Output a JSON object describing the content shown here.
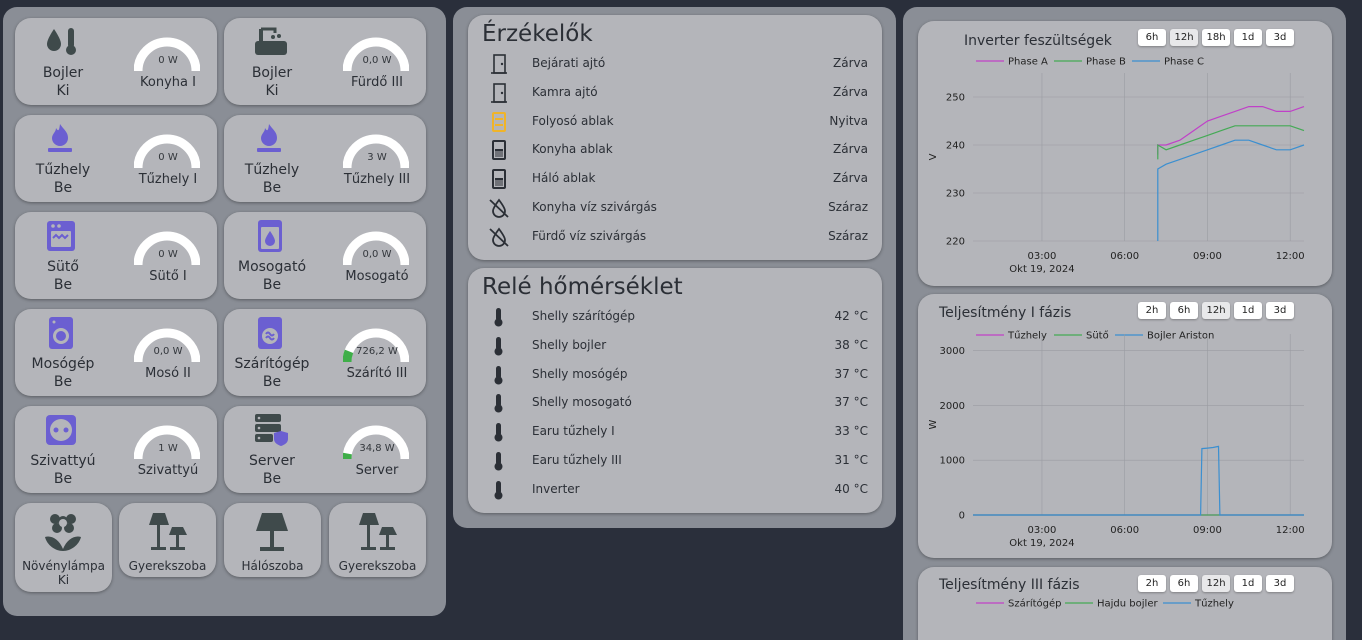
{
  "tiles": [
    {
      "icon": "water-thermometer-icon",
      "name": "Bojler",
      "state": "Ki",
      "gauge_value": "0 W",
      "gauge_name": "Konyha I",
      "fill": 0,
      "icon_color": "#3f4a4b"
    },
    {
      "icon": "bathtub-icon",
      "name": "Bojler",
      "state": "Ki",
      "gauge_value": "0,0 W",
      "gauge_name": "Fürdő III",
      "fill": 0,
      "icon_color": "#3f4a4b"
    },
    {
      "icon": "gas-burner-icon",
      "name": "Tűzhely",
      "state": "Be",
      "gauge_value": "0 W",
      "gauge_name": "Tűzhely I",
      "fill": 0,
      "icon_color": "#6b5fd1"
    },
    {
      "icon": "gas-burner-icon",
      "name": "Tűzhely",
      "state": "Be",
      "gauge_value": "3 W",
      "gauge_name": "Tűzhely III",
      "fill": 0,
      "icon_color": "#6b5fd1"
    },
    {
      "icon": "oven-icon",
      "name": "Sütő",
      "state": "Be",
      "gauge_value": "0 W",
      "gauge_name": "Sütő I",
      "fill": 0,
      "icon_color": "#6b5fd1"
    },
    {
      "icon": "dishwasher-icon",
      "name": "Mosogató",
      "state": "Be",
      "gauge_value": "0,0 W",
      "gauge_name": "Mosogató",
      "fill": 0,
      "icon_color": "#6b5fd1"
    },
    {
      "icon": "washing-machine-icon",
      "name": "Mosógép",
      "state": "Be",
      "gauge_value": "0,0 W",
      "gauge_name": "Mosó II",
      "fill": 0,
      "icon_color": "#6b5fd1"
    },
    {
      "icon": "tumble-dryer-icon",
      "name": "Szárítógép",
      "state": "Be",
      "gauge_value": "726,2 W",
      "gauge_name": "Szárító III",
      "fill": 0.12,
      "icon_color": "#6b5fd1"
    },
    {
      "icon": "power-socket-icon",
      "name": "Szivattyú",
      "state": "Be",
      "gauge_value": "1 W",
      "gauge_name": "Szivattyú",
      "fill": 0,
      "icon_color": "#6b5fd1"
    },
    {
      "icon": "server-shield-icon",
      "name": "Server",
      "state": "Be",
      "gauge_value": "34,8 W",
      "gauge_name": "Server",
      "fill": 0.06,
      "icon_color": "#3f4a4b"
    }
  ],
  "bottom_buttons": [
    {
      "icon": "flower-icon",
      "name": "Növénylámpa",
      "state": "Ki"
    },
    {
      "icon": "lamps-icon",
      "name": "Gyerekszoba"
    },
    {
      "icon": "lamp-icon",
      "name": "Hálószoba"
    },
    {
      "icon": "lamps-icon",
      "name": "Gyerekszoba"
    }
  ],
  "sensors": {
    "title": "Érzékelők",
    "rows": [
      {
        "icon": "door-closed-icon",
        "label": "Bejárati ajtó",
        "value": "Zárva",
        "color": "#2b2f36"
      },
      {
        "icon": "door-closed-icon",
        "label": "Kamra ajtó",
        "value": "Zárva",
        "color": "#2b2f36"
      },
      {
        "icon": "window-open-icon",
        "label": "Folyosó ablak",
        "value": "Nyitva",
        "color": "#f0b429"
      },
      {
        "icon": "window-closed-icon",
        "label": "Konyha ablak",
        "value": "Zárva",
        "color": "#2b2f36"
      },
      {
        "icon": "window-closed-icon",
        "label": "Háló ablak",
        "value": "Zárva",
        "color": "#2b2f36"
      },
      {
        "icon": "water-off-icon",
        "label": "Konyha víz szivárgás",
        "value": "Száraz",
        "color": "#2b2f36"
      },
      {
        "icon": "water-off-icon",
        "label": "Fürdő víz szivárgás",
        "value": "Száraz",
        "color": "#2b2f36"
      }
    ]
  },
  "relay": {
    "title": "Relé hőmérséklet",
    "rows": [
      {
        "icon": "thermometer-icon",
        "label": "Shelly szárítógép",
        "value": "42 °C"
      },
      {
        "icon": "thermometer-icon",
        "label": "Shelly bojler",
        "value": "38 °C"
      },
      {
        "icon": "thermometer-icon",
        "label": "Shelly mosógép",
        "value": "37 °C"
      },
      {
        "icon": "thermometer-icon",
        "label": "Shelly mosogató",
        "value": "37 °C"
      },
      {
        "icon": "thermometer-icon",
        "label": "Earu tűzhely I",
        "value": "33 °C"
      },
      {
        "icon": "thermometer-icon",
        "label": "Earu tűzhely III",
        "value": "31 °C"
      },
      {
        "icon": "thermometer-icon",
        "label": "Inverter",
        "value": "40 °C"
      }
    ]
  },
  "charts": {
    "c1": {
      "title": "Inverter feszültségek",
      "ranges": [
        "6h",
        "12h",
        "18h",
        "1d",
        "3d"
      ],
      "active": "12h"
    },
    "c2": {
      "title": "Teljesítmény I fázis",
      "ranges": [
        "2h",
        "6h",
        "12h",
        "1d",
        "3d"
      ],
      "active": "12h"
    },
    "c3": {
      "title": "Teljesítmény III fázis",
      "ranges": [
        "2h",
        "6h",
        "12h",
        "1d",
        "3d"
      ],
      "active": "12h"
    }
  },
  "chart_data": [
    {
      "type": "line",
      "title": "Inverter feszültségek",
      "ylabel": "V",
      "ylim": [
        220,
        255
      ],
      "yticks": [
        220,
        230,
        240,
        250
      ],
      "xticks": [
        "03:00",
        "06:00",
        "09:00",
        "12:00"
      ],
      "xsub": "Okt 19, 2024",
      "xlim": [
        0.5,
        12.5
      ],
      "series": [
        {
          "name": "Phase A",
          "color": "#c040c8",
          "x": [
            7.2,
            7.2,
            7.5,
            8.0,
            8.5,
            9.0,
            9.5,
            10.0,
            10.5,
            11.0,
            11.5,
            12.0,
            12.5
          ],
          "y": [
            238,
            240,
            240,
            241,
            243,
            245,
            246,
            247,
            248,
            248,
            247,
            247,
            248
          ]
        },
        {
          "name": "Phase B",
          "color": "#44aa55",
          "x": [
            7.2,
            7.2,
            7.5,
            8.0,
            8.5,
            9.0,
            9.5,
            10.0,
            10.5,
            11.0,
            11.5,
            12.0,
            12.5
          ],
          "y": [
            237,
            240,
            239,
            240,
            241,
            242,
            243,
            244,
            244,
            244,
            244,
            244,
            243
          ]
        },
        {
          "name": "Phase C",
          "color": "#3b8fd0",
          "x": [
            7.2,
            7.2,
            7.5,
            8.0,
            8.5,
            9.0,
            9.5,
            10.0,
            10.5,
            11.0,
            11.5,
            12.0,
            12.5
          ],
          "y": [
            220,
            235,
            236,
            237,
            238,
            239,
            240,
            241,
            241,
            240,
            239,
            239,
            240
          ]
        }
      ]
    },
    {
      "type": "line",
      "title": "Teljesítmény I fázis",
      "ylabel": "W",
      "ylim": [
        0,
        3300
      ],
      "yticks": [
        0,
        1000,
        2000,
        3000
      ],
      "xticks": [
        "03:00",
        "06:00",
        "09:00",
        "12:00"
      ],
      "xsub": "Okt 19, 2024",
      "xlim": [
        0.5,
        12.5
      ],
      "series": [
        {
          "name": "Tűzhely",
          "color": "#c040c8",
          "x": [
            0.5,
            12.5
          ],
          "y": [
            0,
            0
          ]
        },
        {
          "name": "Sütő",
          "color": "#44aa55",
          "x": [
            0.5,
            12.5
          ],
          "y": [
            0,
            0
          ]
        },
        {
          "name": "Bojler Ariston",
          "color": "#3b8fd0",
          "x": [
            0.5,
            8.75,
            8.8,
            9.0,
            9.2,
            9.4,
            9.45,
            12.5
          ],
          "y": [
            0,
            0,
            1210,
            1220,
            1230,
            1250,
            0,
            0
          ]
        }
      ]
    },
    {
      "type": "line",
      "title": "Teljesítmény III fázis",
      "series": [
        {
          "name": "Szárítógép",
          "color": "#c040c8",
          "x": [],
          "y": []
        },
        {
          "name": "Hajdu bojler",
          "color": "#44aa55",
          "x": [],
          "y": []
        },
        {
          "name": "Tűzhely",
          "color": "#3b8fd0",
          "x": [],
          "y": []
        }
      ]
    }
  ]
}
